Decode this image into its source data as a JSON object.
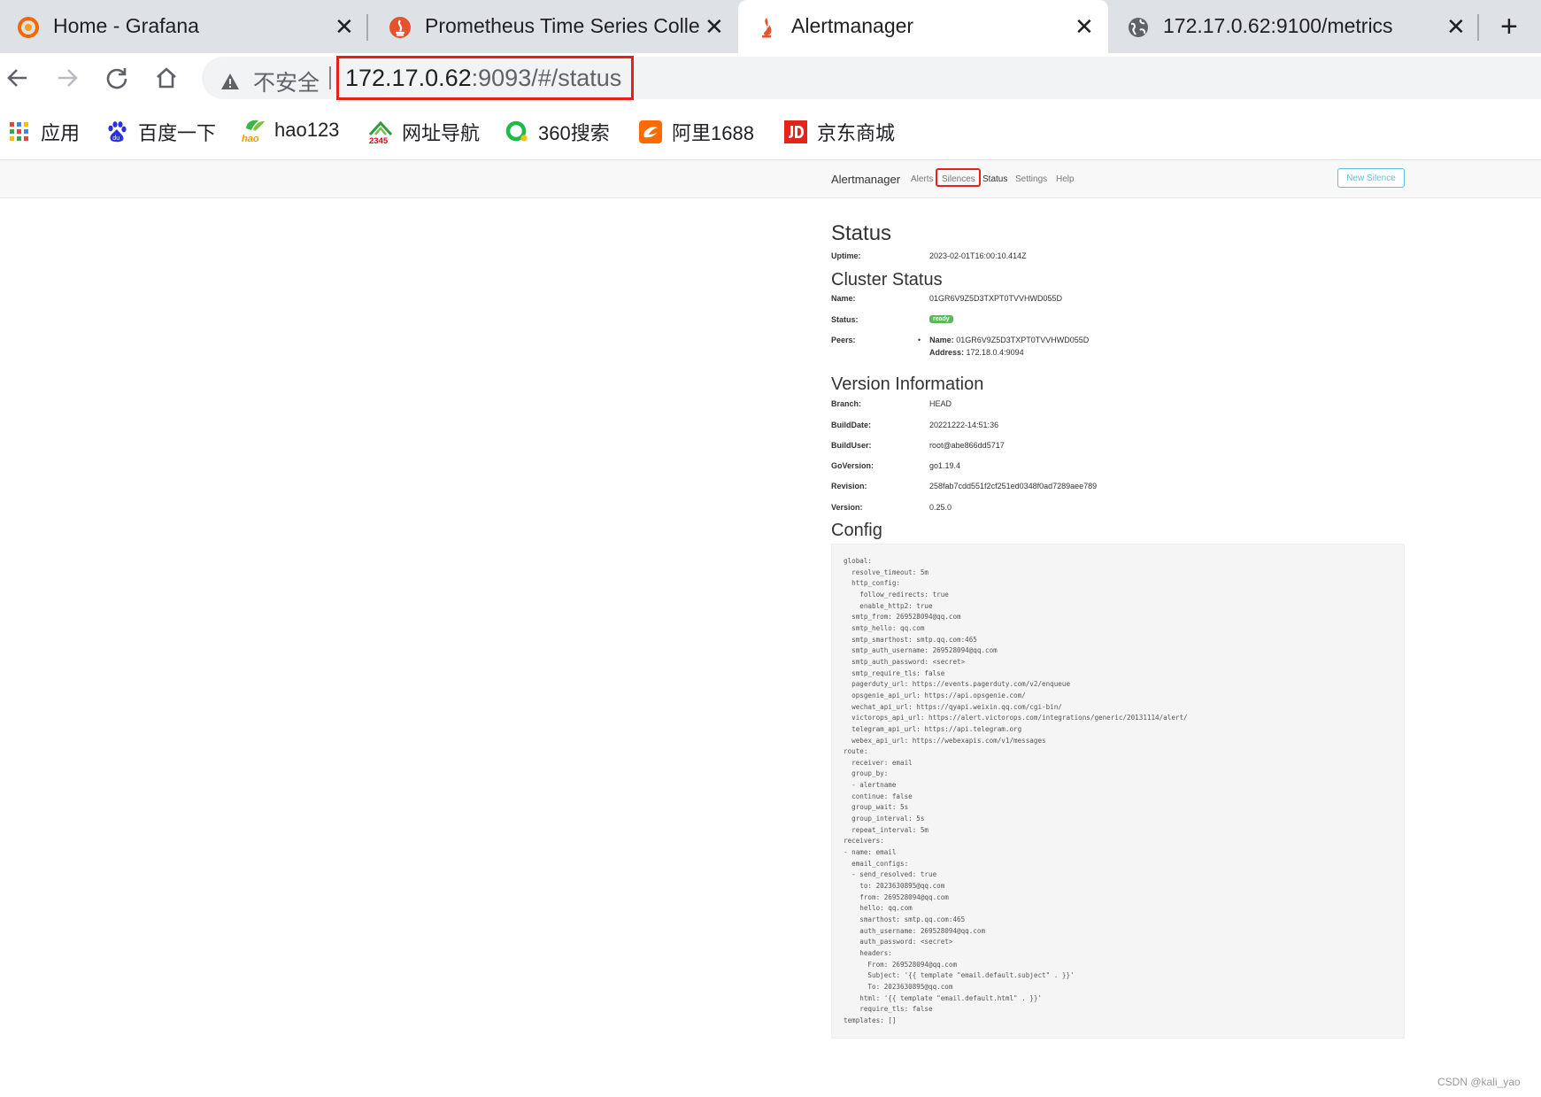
{
  "browser": {
    "tabs": [
      {
        "title": "Home - Grafana",
        "icon": "grafana-icon",
        "active": false
      },
      {
        "title": "Prometheus Time Series Collec",
        "icon": "prometheus-icon",
        "active": false
      },
      {
        "title": "Alertmanager",
        "icon": "prometheus-icon",
        "active": true
      },
      {
        "title": "172.17.0.62:9100/metrics",
        "icon": "globe-icon",
        "active": false
      }
    ],
    "new_tab_glyph": "+",
    "close_glyph": "✕",
    "security_label": "不安全",
    "url_host": "172.17.0.62",
    "url_rest": ":9093/#/status",
    "bookmarks": [
      {
        "label": "应用",
        "icon": "apps-grid-icon"
      },
      {
        "label": "百度一下",
        "icon": "baidu-paw-icon"
      },
      {
        "label": "hao123",
        "icon": "hao123-icon"
      },
      {
        "label": "网址导航",
        "icon": "2345-icon"
      },
      {
        "label": "360搜索",
        "icon": "360-search-icon"
      },
      {
        "label": "阿里1688",
        "icon": "alibaba-1688-icon"
      },
      {
        "label": "京东商城",
        "icon": "jd-icon"
      }
    ]
  },
  "alertmanager": {
    "brand": "Alertmanager",
    "nav": [
      "Alerts",
      "Silences",
      "Status",
      "Settings",
      "Help"
    ],
    "new_silence": "New Silence",
    "page_title": "Status",
    "uptime_label": "Uptime:",
    "uptime": "2023-02-01T16:00:10.414Z",
    "cluster": {
      "heading": "Cluster Status",
      "name_label": "Name:",
      "name": "01GR6V9Z5D3TXPT0TVVHWD055D",
      "status_label": "Status:",
      "status": "ready",
      "peers_label": "Peers:",
      "peer_name_label": "Name:",
      "peer_name": "01GR6V9Z5D3TXPT0TVVHWD055D",
      "peer_address_label": "Address:",
      "peer_address": "172.18.0.4:9094"
    },
    "version": {
      "heading": "Version Information",
      "rows": [
        {
          "label": "Branch:",
          "value": "HEAD"
        },
        {
          "label": "BuildDate:",
          "value": "20221222-14:51:36"
        },
        {
          "label": "BuildUser:",
          "value": "root@abe866dd5717"
        },
        {
          "label": "GoVersion:",
          "value": "go1.19.4"
        },
        {
          "label": "Revision:",
          "value": "258fab7cdd551f2cf251ed0348f0ad7289aee789"
        },
        {
          "label": "Version:",
          "value": "0.25.0"
        }
      ]
    },
    "config_heading": "Config",
    "config_text": "global:\n  resolve_timeout: 5m\n  http_config:\n    follow_redirects: true\n    enable_http2: true\n  smtp_from: 269528094@qq.com\n  smtp_hello: qq.com\n  smtp_smarthost: smtp.qq.com:465\n  smtp_auth_username: 269528094@qq.com\n  smtp_auth_password: <secret>\n  smtp_require_tls: false\n  pagerduty_url: https://events.pagerduty.com/v2/enqueue\n  opsgenie_api_url: https://api.opsgenie.com/\n  wechat_api_url: https://qyapi.weixin.qq.com/cgi-bin/\n  victorops_api_url: https://alert.victorops.com/integrations/generic/20131114/alert/\n  telegram_api_url: https://api.telegram.org\n  webex_api_url: https://webexapis.com/v1/messages\nroute:\n  receiver: email\n  group_by:\n  - alertname\n  continue: false\n  group_wait: 5s\n  group_interval: 5s\n  repeat_interval: 5m\nreceivers:\n- name: email\n  email_configs:\n  - send_resolved: true\n    to: 2023630895@qq.com\n    from: 269528094@qq.com\n    hello: qq.com\n    smarthost: smtp.qq.com:465\n    auth_username: 269528094@qq.com\n    auth_password: <secret>\n    headers:\n      From: 269528094@qq.com\n      Subject: '{{ template \"email.default.subject\" . }}'\n      To: 2023630895@qq.com\n    html: '{{ template \"email.default.html\" . }}'\n    require_tls: false\ntemplates: []"
  },
  "watermark": "CSDN @kali_yao",
  "colors": {
    "highlight_box": "#e8201c",
    "ready_badge": "#5cb85c",
    "new_silence_border": "#5bc0de"
  }
}
